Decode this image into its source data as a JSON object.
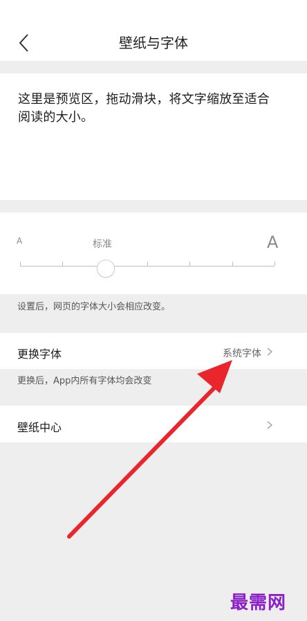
{
  "header": {
    "title": "壁纸与字体"
  },
  "preview": {
    "text": "这里是预览区，拖动滑块，将文字缩放至适合阅读的大小。"
  },
  "font_size": {
    "small_label": "A",
    "large_label": "A",
    "current_label": "标准",
    "steps": 7,
    "current_step": 2,
    "hint": "设置后，网页的字体大小会相应改变。"
  },
  "change_font": {
    "label": "更换字体",
    "value": "系统字体",
    "hint": "更换后，App内所有字体均会改变"
  },
  "wallpaper": {
    "label": "壁纸中心"
  },
  "watermark": {
    "text": "最需网"
  },
  "colors": {
    "annotation_arrow": "#e8262c",
    "watermark": "#8a1ec8",
    "section_background": "#eeeeee"
  }
}
